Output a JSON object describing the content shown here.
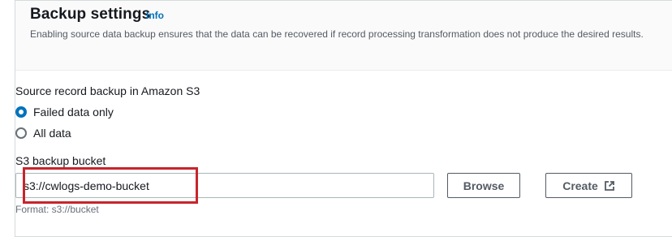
{
  "header": {
    "title": "Backup settings",
    "info_link": "Info",
    "description": "Enabling source data backup ensures that the data can be recovered if record processing transformation does not produce the desired results."
  },
  "source_backup": {
    "label": "Source record backup in Amazon S3",
    "options": [
      {
        "label": "Failed data only",
        "selected": true
      },
      {
        "label": "All data",
        "selected": false
      }
    ]
  },
  "bucket": {
    "label": "S3 backup bucket",
    "value": "s3://cwlogs-demo-bucket",
    "constraint": "Format: s3://bucket",
    "browse_label": "Browse",
    "create_label": "Create",
    "create_icon": "external-link-icon"
  },
  "colors": {
    "accent": "#0073bb",
    "highlight": "#c7252c",
    "header_bg": "#fafafa"
  }
}
